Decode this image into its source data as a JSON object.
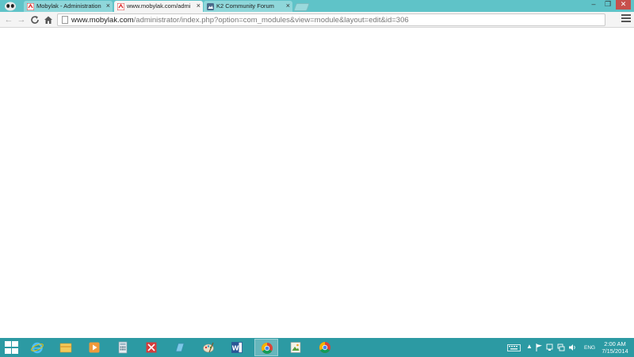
{
  "browser": {
    "tabs": [
      {
        "title": "Mobylak - Administration",
        "close": "×",
        "active": false
      },
      {
        "title": "www.mobylak.com/admi",
        "close": "×",
        "active": true
      },
      {
        "title": "K2 Community Forum",
        "close": "×",
        "active": false
      }
    ],
    "window_controls": {
      "minimize": "–",
      "restore": "❐",
      "close": "✕"
    },
    "nav": {
      "back": "←",
      "forward": "→",
      "reload": "C",
      "home": "⌂"
    },
    "address": {
      "host": "www.mobylak.com",
      "path": "/administrator/index.php?option=com_modules&view=module&layout=edit&id=306"
    },
    "bookmark_star": "☆"
  },
  "taskbar": {
    "apps": [
      {
        "name": "internet-explorer",
        "active": false
      },
      {
        "name": "file-explorer",
        "active": false
      },
      {
        "name": "media-player",
        "active": false
      },
      {
        "name": "calculator",
        "active": false
      },
      {
        "name": "red-app",
        "active": false
      },
      {
        "name": "blue-app",
        "active": false
      },
      {
        "name": "paint-app",
        "active": false
      },
      {
        "name": "microsoft-word",
        "active": false
      },
      {
        "name": "chrome",
        "active": true
      },
      {
        "name": "image-viewer",
        "active": false
      },
      {
        "name": "chrome-second",
        "active": false
      }
    ],
    "tray": {
      "language": "ENG"
    },
    "clock": {
      "time": "2:00 AM",
      "date": "7/15/2014"
    }
  },
  "colors": {
    "titlebar": "#5fc3c8",
    "taskbar": "#2c9aa3",
    "close_button": "#c7504c"
  }
}
